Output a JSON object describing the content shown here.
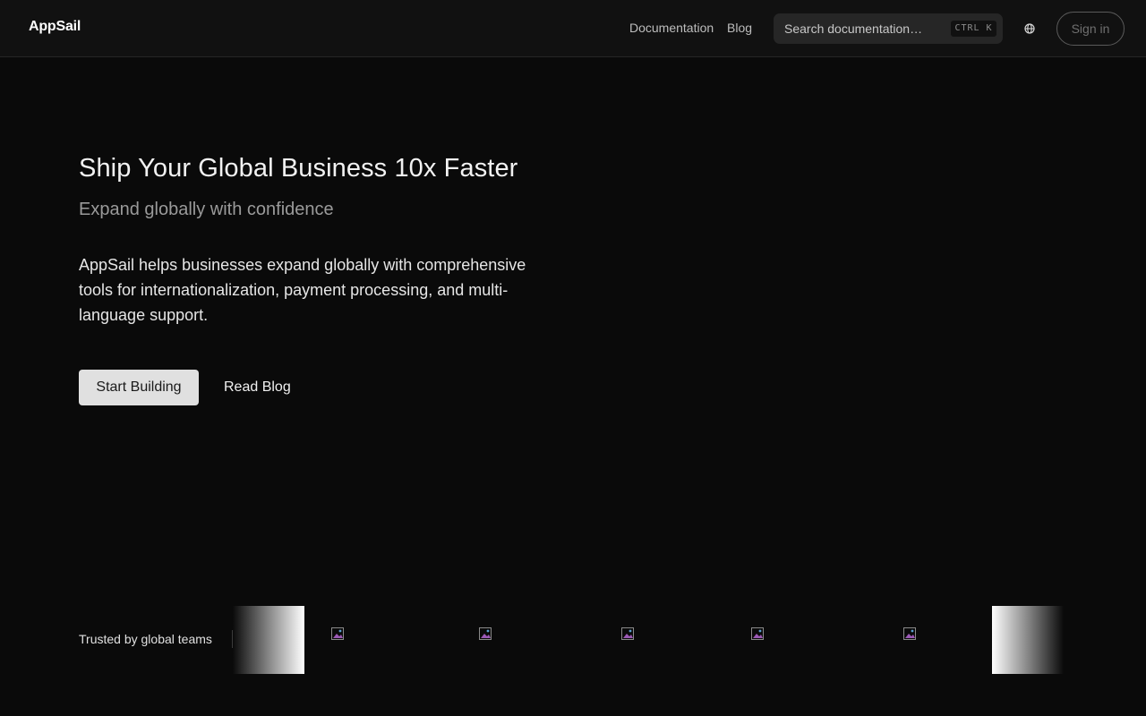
{
  "header": {
    "brand": "AppSail",
    "nav": [
      {
        "label": "Documentation"
      },
      {
        "label": "Blog"
      }
    ],
    "search": {
      "placeholder": "Search documentation…",
      "shortcut": "CTRL K"
    },
    "language_icon": "globe-icon",
    "sign_in_label": "Sign in"
  },
  "hero": {
    "title": "Ship Your Global Business 10x Faster",
    "subtitle": "Expand globally with confidence",
    "description": "AppSail helps businesses expand globally with comprehensive tools for internationalization, payment processing, and multi-language support.",
    "primary_cta": "Start Building",
    "secondary_cta": "Read Blog"
  },
  "trusted": {
    "label": "Trusted by global teams",
    "logos": [
      {
        "icon": "broken-image-icon"
      },
      {
        "icon": "broken-image-icon"
      },
      {
        "icon": "broken-image-icon"
      },
      {
        "icon": "broken-image-icon"
      },
      {
        "icon": "broken-image-icon"
      }
    ]
  },
  "colors": {
    "background": "#0a0a0a",
    "header_background": "#111111",
    "primary_button": "#e0e0e0",
    "search_background": "#262626"
  }
}
